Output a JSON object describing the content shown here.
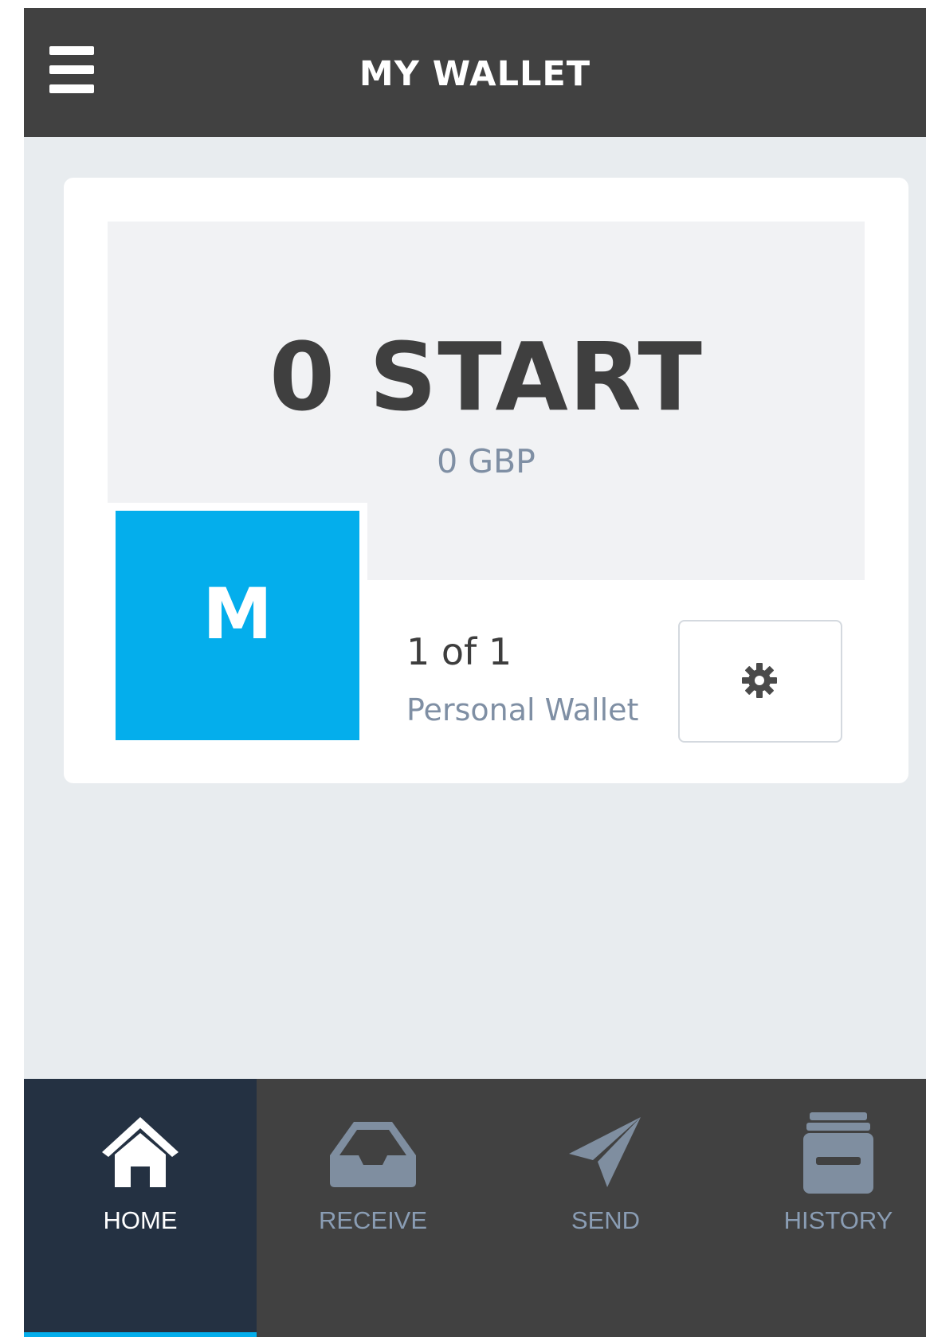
{
  "header": {
    "title": "MY WALLET"
  },
  "wallet": {
    "balance": "0 START",
    "fiat_balance": "0 GBP",
    "avatar_letter": "M",
    "position": "1 of 1",
    "type": "Personal Wallet"
  },
  "nav": {
    "items": [
      {
        "label": "HOME",
        "icon": "home-icon",
        "active": true
      },
      {
        "label": "RECEIVE",
        "icon": "inbox-icon",
        "active": false
      },
      {
        "label": "SEND",
        "icon": "paper-plane-icon",
        "active": false
      },
      {
        "label": "HISTORY",
        "icon": "archive-icon",
        "active": false
      }
    ]
  },
  "colors": {
    "header_bg": "#414141",
    "accent": "#04aeec",
    "active_nav_bg": "#243142",
    "muted_text": "#7f8fa4"
  }
}
